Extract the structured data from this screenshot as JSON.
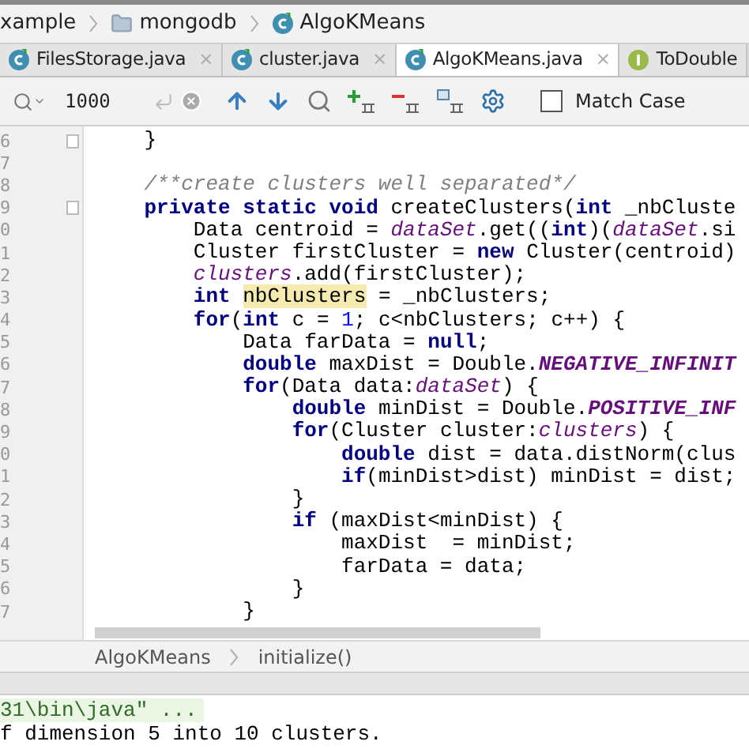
{
  "breadcrumbs": [
    {
      "label": "xample",
      "kind": "text"
    },
    {
      "label": "mongodb",
      "kind": "folder"
    },
    {
      "label": "AlgoKMeans",
      "kind": "class"
    }
  ],
  "tabs": [
    {
      "label": "FilesStorage.java",
      "kind": "class",
      "selected": false,
      "close": "×"
    },
    {
      "label": "cluster.java",
      "kind": "class",
      "selected": false,
      "close": "×"
    },
    {
      "label": "AlgoKMeans.java",
      "kind": "class",
      "selected": true,
      "close": "×"
    },
    {
      "label": "ToDouble",
      "kind": "interface",
      "selected": false
    }
  ],
  "search": {
    "value": "1000"
  },
  "match_case": {
    "label": "Match Case",
    "checked": false
  },
  "code_lines": [
    {
      "number": "6",
      "fold": true,
      "tokens": [
        {
          "text": "    }",
          "kind": "plain"
        }
      ]
    },
    {
      "number": "7",
      "fold": false
    },
    {
      "number": "8",
      "fold": false,
      "tokens": [
        {
          "text": "    /**create clusters well separated*/",
          "kind": "comment"
        }
      ]
    },
    {
      "number": "9",
      "fold": true,
      "tokens": [
        {
          "text": "    private static void ",
          "kind": "keyword"
        },
        {
          "text": "createClusters(",
          "kind": "plain"
        },
        {
          "text": "int ",
          "kind": "keyword"
        },
        {
          "text": "_nbCluste",
          "kind": "plain"
        }
      ]
    },
    {
      "number": "0",
      "fold": false,
      "tokens": [
        {
          "text": "        Data centroid = ",
          "kind": "plain"
        },
        {
          "text": "dataSet",
          "kind": "field"
        },
        {
          "text": ".get((",
          "kind": "plain"
        },
        {
          "text": "int",
          "kind": "keyword"
        },
        {
          "text": ")(",
          "kind": "plain"
        },
        {
          "text": "dataSet",
          "kind": "field"
        },
        {
          "text": ".si",
          "kind": "plain"
        }
      ]
    },
    {
      "number": "1",
      "fold": false,
      "tokens": [
        {
          "text": "        Cluster firstCluster = ",
          "kind": "plain"
        },
        {
          "text": "new ",
          "kind": "keyword"
        },
        {
          "text": "Cluster(centroid)",
          "kind": "plain"
        }
      ]
    },
    {
      "number": "2",
      "fold": false,
      "tokens": [
        {
          "text": "        clusters",
          "kind": "field"
        },
        {
          "text": ".add(firstCluster);",
          "kind": "plain"
        }
      ]
    },
    {
      "number": "3",
      "fold": false,
      "tokens": [
        {
          "text": "        int ",
          "kind": "keyword"
        },
        {
          "text": "nbClusters",
          "kind": "highlight"
        },
        {
          "text": " = _nbClusters;",
          "kind": "plain"
        }
      ]
    },
    {
      "number": "4",
      "fold": false,
      "tokens": [
        {
          "text": "        for",
          "kind": "keyword"
        },
        {
          "text": "(",
          "kind": "plain"
        },
        {
          "text": "int ",
          "kind": "keyword"
        },
        {
          "text": "c = ",
          "kind": "plain"
        },
        {
          "text": "1",
          "kind": "number"
        },
        {
          "text": "; c<nbClusters; c++) {",
          "kind": "plain"
        }
      ]
    },
    {
      "number": "5",
      "fold": false,
      "tokens": [
        {
          "text": "            Data farData = ",
          "kind": "plain"
        },
        {
          "text": "null",
          "kind": "keyword"
        },
        {
          "text": ";",
          "kind": "plain"
        }
      ]
    },
    {
      "number": "6",
      "fold": false,
      "tokens": [
        {
          "text": "            double ",
          "kind": "keyword"
        },
        {
          "text": "maxDist = Double.",
          "kind": "plain"
        },
        {
          "text": "NEGATIVE_INFINIT",
          "kind": "constant"
        }
      ]
    },
    {
      "number": "7",
      "fold": false,
      "tokens": [
        {
          "text": "            for",
          "kind": "keyword"
        },
        {
          "text": "(Data data:",
          "kind": "plain"
        },
        {
          "text": "dataSet",
          "kind": "field"
        },
        {
          "text": ") {",
          "kind": "plain"
        }
      ]
    },
    {
      "number": "8",
      "fold": false,
      "tokens": [
        {
          "text": "                double ",
          "kind": "keyword"
        },
        {
          "text": "minDist = Double.",
          "kind": "plain"
        },
        {
          "text": "POSITIVE_INF",
          "kind": "constant"
        }
      ]
    },
    {
      "number": "9",
      "fold": false,
      "tokens": [
        {
          "text": "                for",
          "kind": "keyword"
        },
        {
          "text": "(Cluster cluster:",
          "kind": "plain"
        },
        {
          "text": "clusters",
          "kind": "field"
        },
        {
          "text": ") {",
          "kind": "plain"
        }
      ]
    },
    {
      "number": "0",
      "fold": false,
      "tokens": [
        {
          "text": "                    double ",
          "kind": "keyword"
        },
        {
          "text": "dist = data.distNorm(clus",
          "kind": "plain"
        }
      ]
    },
    {
      "number": "1",
      "fold": false,
      "tokens": [
        {
          "text": "                    if",
          "kind": "keyword"
        },
        {
          "text": "(minDist>dist) minDist = dist;",
          "kind": "plain"
        }
      ]
    },
    {
      "number": "2",
      "fold": false,
      "tokens": [
        {
          "text": "                }",
          "kind": "plain"
        }
      ]
    },
    {
      "number": "3",
      "fold": false,
      "tokens": [
        {
          "text": "                if ",
          "kind": "keyword"
        },
        {
          "text": "(maxDist<minDist) {",
          "kind": "plain"
        }
      ]
    },
    {
      "number": "4",
      "fold": false,
      "tokens": [
        {
          "text": "                    maxDist  = minDist;",
          "kind": "plain"
        }
      ]
    },
    {
      "number": "5",
      "fold": false,
      "tokens": [
        {
          "text": "                    farData = data;",
          "kind": "plain"
        }
      ]
    },
    {
      "number": "6",
      "fold": false,
      "tokens": [
        {
          "text": "                }",
          "kind": "plain"
        }
      ]
    },
    {
      "number": "7",
      "fold": false,
      "tokens": [
        {
          "text": "            }",
          "kind": "plain"
        }
      ]
    }
  ],
  "editor_breadcrumbs": [
    "AlgoKMeans",
    "initialize()"
  ],
  "console": [
    {
      "text": "31\\bin\\java\" ...",
      "kind": "command"
    },
    {
      "text": "f dimension 5 into 10 clusters.",
      "kind": "output"
    }
  ]
}
